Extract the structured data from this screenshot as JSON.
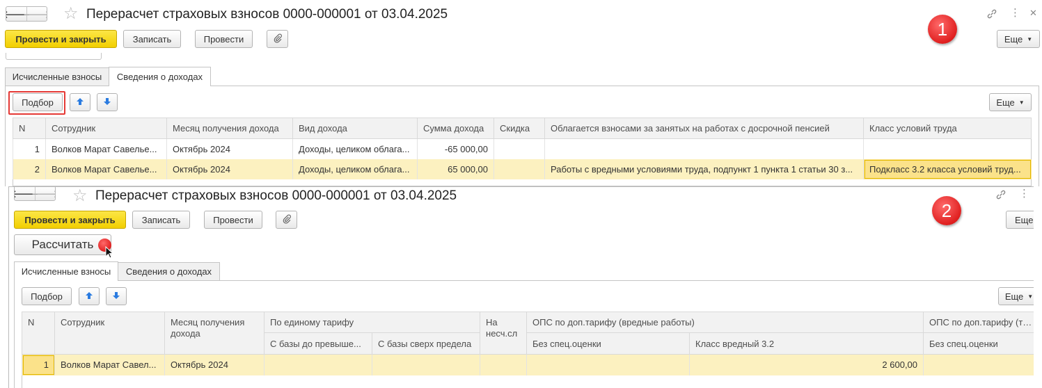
{
  "top": {
    "title": "Перерасчет страховых взносов 0000-000001 от 03.04.2025",
    "badge": "1",
    "nav": {
      "back": "🡐",
      "forward": "🡒"
    },
    "icons": {
      "star": "☆",
      "link": "🔗",
      "more": "⋮",
      "close": "✕",
      "clip": "📎",
      "up": "🡅",
      "down": "🡇"
    },
    "toolbar": {
      "post_close": "Провести и закрыть",
      "save": "Записать",
      "post": "Провести",
      "more": "Еще"
    },
    "tabs": [
      "Исчисленные взносы",
      "Сведения о доходах"
    ],
    "active_tab": 1,
    "tab_toolbar": {
      "pick": "Подбор",
      "more": "Еще"
    },
    "table": {
      "headers": [
        "N",
        "Сотрудник",
        "Месяц получения дохода",
        "Вид дохода",
        "Сумма дохода",
        "Скидка",
        "Облагается взносами за занятых на работах с досрочной пенсией",
        "Класс условий труда"
      ],
      "rows": [
        [
          "1",
          "Волков Марат Савелье...",
          "Октябрь 2024",
          "Доходы, целиком облага...",
          "-65 000,00",
          "",
          "",
          ""
        ],
        [
          "2",
          "Волков Марат Савелье...",
          "Октябрь 2024",
          "Доходы, целиком облага...",
          "65 000,00",
          "",
          "Работы с вредными условиями труда, подпункт 1 пункта 1 статьи 30 з...",
          "Подкласс 3.2 класса условий труд..."
        ]
      ]
    }
  },
  "bottom": {
    "title": "Перерасчет страховых взносов 0000-000001 от 03.04.2025",
    "badge": "2",
    "toolbar": {
      "post_close": "Провести и закрыть",
      "save": "Записать",
      "post": "Провести",
      "more": "Еще",
      "calculate": "Рассчитать"
    },
    "tabs": [
      "Исчисленные взносы",
      "Сведения о доходах"
    ],
    "active_tab": 0,
    "tab_toolbar": {
      "pick": "Подбор",
      "more": "Еще"
    },
    "table": {
      "headers": {
        "n": "N",
        "employee": "Сотрудник",
        "month": "Месяц получения дохода",
        "single_tariff": "По единому тарифу",
        "base_below": "С базы до превыше...",
        "base_above": "С базы сверх предела",
        "minor_accident": "На несч.сл",
        "ops_harmful": "ОПС по доп.тарифу (вредные работы)",
        "no_special": "Без спец.оценки",
        "harmful_class": "Класс вредный 3.2",
        "ops_heavy": "ОПС по доп.тарифу (тяже",
        "no_special2": "Без спец.оценки"
      },
      "rows": [
        [
          "1",
          "Волков Марат Савел...",
          "Октябрь 2024",
          "",
          "",
          "",
          "",
          "2 600,00",
          ""
        ]
      ]
    }
  }
}
